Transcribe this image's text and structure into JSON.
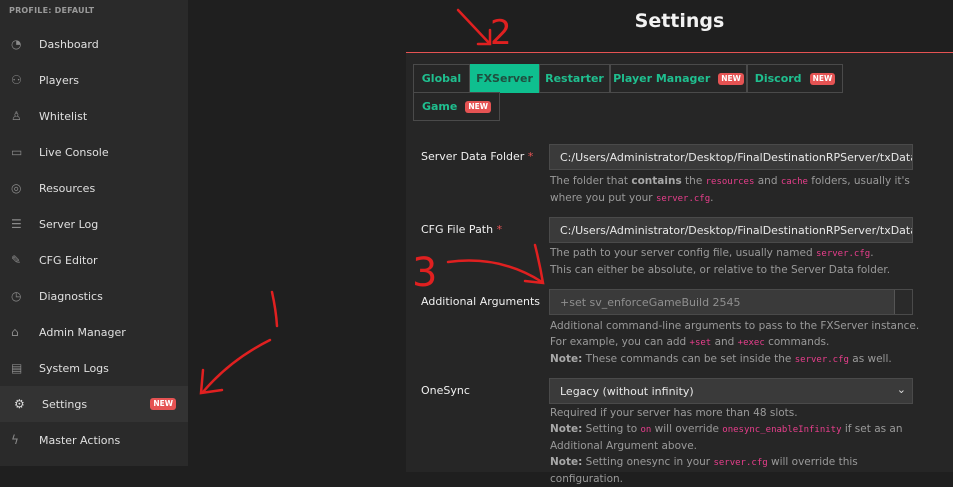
{
  "sidebar": {
    "profile": "PROFILE: DEFAULT",
    "items": [
      {
        "label": "Dashboard",
        "icon": "dashboard-icon"
      },
      {
        "label": "Players",
        "icon": "players-icon"
      },
      {
        "label": "Whitelist",
        "icon": "whitelist-icon"
      },
      {
        "label": "Live Console",
        "icon": "console-icon"
      },
      {
        "label": "Resources",
        "icon": "resources-icon"
      },
      {
        "label": "Server Log",
        "icon": "log-icon"
      },
      {
        "label": "CFG Editor",
        "icon": "pencil-icon"
      },
      {
        "label": "Diagnostics",
        "icon": "diagnostics-icon"
      },
      {
        "label": "Admin Manager",
        "icon": "admin-icon"
      },
      {
        "label": "System Logs",
        "icon": "system-logs-icon"
      },
      {
        "label": "Settings",
        "icon": "gear-icon",
        "badge": "NEW",
        "active": true
      },
      {
        "label": "Master Actions",
        "icon": "bolt-icon"
      }
    ]
  },
  "page": {
    "title": "Settings"
  },
  "tabs": [
    {
      "label": "Global"
    },
    {
      "label": "FXServer",
      "active": true
    },
    {
      "label": "Restarter"
    },
    {
      "label": "Player Manager",
      "badge": "NEW"
    },
    {
      "label": "Discord",
      "badge": "NEW"
    },
    {
      "label": "Game",
      "badge": "NEW"
    }
  ],
  "form": {
    "server_data_folder": {
      "label": "Server Data Folder",
      "required": "*",
      "value": "C:/Users/Administrator/Desktop/FinalDestinationRPServer/txData/CFXDefa",
      "help": [
        "The folder that ",
        "contains",
        " the ",
        "resources",
        " and ",
        "cache",
        " folders, usually it's where you put your ",
        "server.cfg",
        "."
      ]
    },
    "cfg_file_path": {
      "label": "CFG File Path",
      "required": "*",
      "value": "C:/Users/Administrator/Desktop/FinalDestinationRPServer/txData/CFXDefa",
      "help1": [
        "The path to your server config file, usually named ",
        "server.cfg",
        "."
      ],
      "help2": "This can either be absolute, or relative to the Server Data folder."
    },
    "additional_arguments": {
      "label": "Additional Arguments",
      "placeholder": "+set sv_enforceGameBuild 2545",
      "help1": "Additional command-line arguments to pass to the FXServer instance.",
      "help2": [
        "For example, you can add ",
        "+set",
        " and ",
        "+exec",
        " commands."
      ],
      "help3": [
        "Note:",
        " These commands can be set inside the ",
        "server.cfg",
        " as well."
      ]
    },
    "onesync": {
      "label": "OneSync",
      "value": "Legacy (without infinity)",
      "help1": "Required if your server has more than 48 slots.",
      "help2": [
        "Note:",
        " Setting to ",
        "on",
        " will override ",
        "onesync_enableInfinity",
        " if set as an Additional Argument above."
      ],
      "help3": [
        "Note:",
        " Setting onesync in your ",
        "server.cfg",
        " will override this configuration."
      ]
    }
  },
  "annotations": {
    "one": "1",
    "two": "2",
    "three": "3",
    "color": "#e02020"
  }
}
